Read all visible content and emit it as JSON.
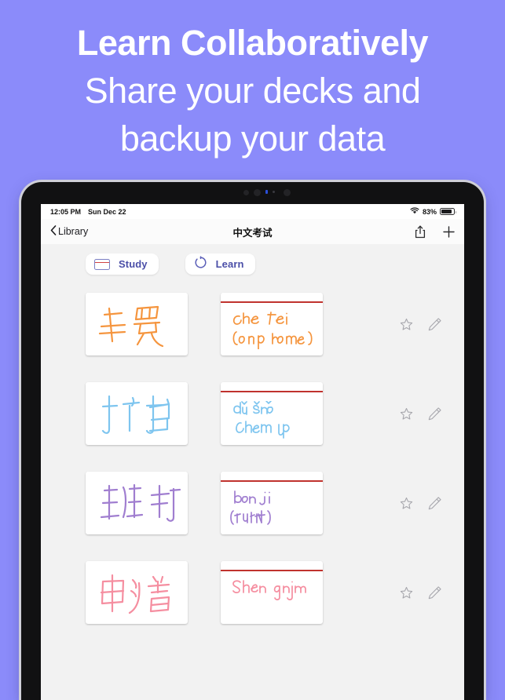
{
  "promo": {
    "line1": "Learn Collaboratively",
    "line2": "Share your decks and",
    "line3": "backup your data",
    "background_color": "#8b8bfa",
    "text_color": "#ffffff"
  },
  "statusbar": {
    "time": "12:05 PM",
    "date": "Sun Dec 22",
    "battery_percent": "83%",
    "wifi_icon": "wifi-icon",
    "battery_icon": "battery-icon"
  },
  "navbar": {
    "back_label": "Library",
    "back_icon": "chevron-left-icon",
    "title": "中文考试",
    "share_icon": "share-icon",
    "add_icon": "plus-icon"
  },
  "modes": [
    {
      "label": "Study",
      "icon": "flashcard-icon",
      "selected": true
    },
    {
      "label": "Learn",
      "icon": "circular-arrow-icon",
      "selected": false
    }
  ],
  "accents": {
    "mode_text": "#4b4fa8",
    "rule_line": "#c0322e",
    "screen_bg": "#f2f2f2",
    "card_bg": "#ffffff"
  },
  "row_actions": {
    "star_icon": "star-outline-icon",
    "edit_icon": "pencil-icon"
  },
  "cards": [
    {
      "front_text": "车费",
      "back_pinyin": "Che fei",
      "back_meaning": "(cab fare)",
      "ink_color": "#f5953e"
    },
    {
      "front_text": "打扫",
      "back_pinyin": "dǔ sǎo",
      "back_meaning": "clean up",
      "ink_color": "#7ec5ef"
    },
    {
      "front_text": "班机",
      "back_pinyin": "ban ji",
      "back_meaning": "(flight)",
      "ink_color": "#a07ed0"
    },
    {
      "front_text": "申请",
      "back_pinyin": "Shen qing",
      "back_meaning": "",
      "ink_color": "#f58ea0"
    }
  ]
}
